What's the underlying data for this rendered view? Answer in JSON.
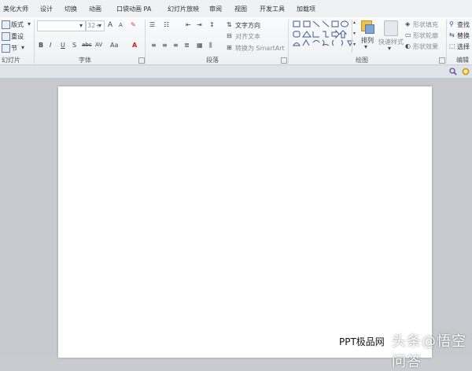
{
  "tabs": [
    "美化大师",
    "设计",
    "切换",
    "动画",
    "口袋动画 PA",
    "幻灯片放映",
    "审阅",
    "视图",
    "开发工具",
    "加载项"
  ],
  "slides_group": {
    "layout_label": "版式",
    "reset_label": "重设",
    "section_label": "节",
    "group_label": "幻灯片"
  },
  "font_group": {
    "size_value": "32+",
    "bold": "B",
    "italic": "I",
    "underline": "U",
    "shadow": "S",
    "strikethrough": "abc",
    "spacing": "AV",
    "case": "Aa",
    "grow": "A",
    "shrink": "A",
    "group_label": "字体"
  },
  "paragraph_group": {
    "text_direction_label": "文字方向",
    "align_text_label": "对齐文本",
    "convert_smartart_label": "转换为 SmartArt",
    "group_label": "段落"
  },
  "drawing_group": {
    "arrange_label": "排列",
    "quick_styles_label": "快速样式",
    "shape_fill_label": "形状填充",
    "shape_outline_label": "形状轮廓",
    "shape_effects_label": "形状效果",
    "group_label": "绘图"
  },
  "editing_group": {
    "find_label": "查找",
    "replace_label": "替换",
    "select_label": "选择",
    "group_label": "编辑"
  },
  "watermark": {
    "ppt_text": "PPT极品网",
    "source_text": "头条@悟空问答"
  }
}
